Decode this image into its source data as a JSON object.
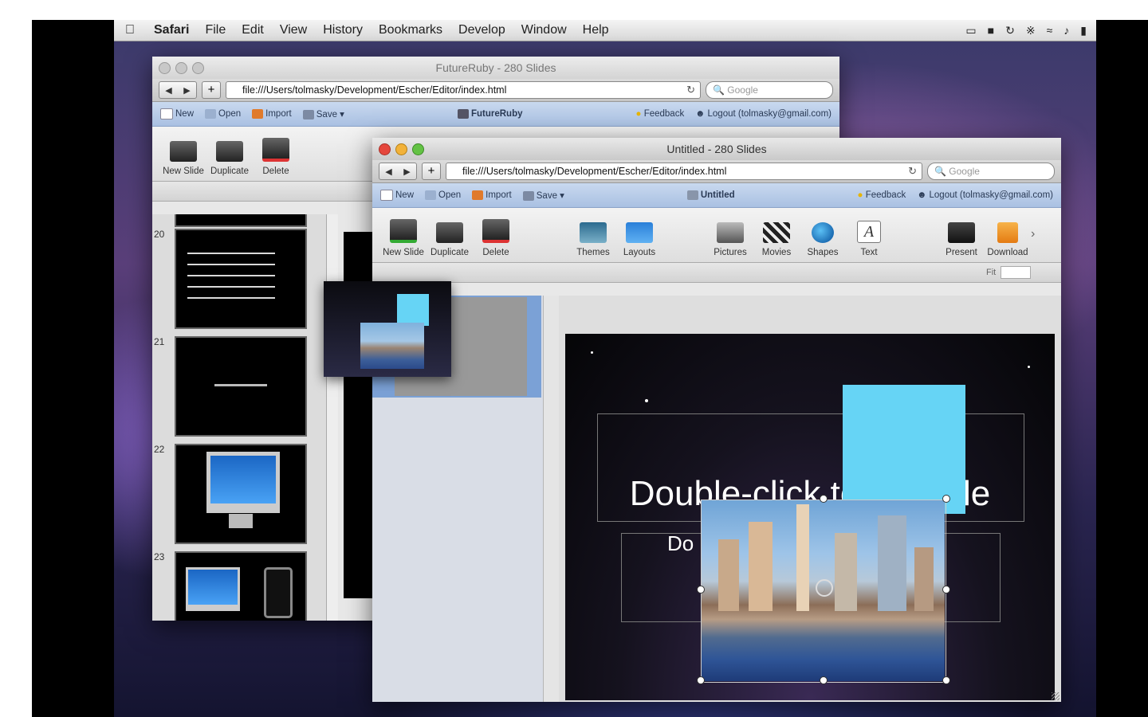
{
  "menubar": {
    "app": "Safari",
    "items": [
      "File",
      "Edit",
      "View",
      "History",
      "Bookmarks",
      "Develop",
      "Window",
      "Help"
    ]
  },
  "back_window": {
    "title": "FutureRuby - 280 Slides",
    "url": "file:///Users/tolmasky/Development/Escher/Editor/index.html",
    "search_placeholder": "Google",
    "toolbar": {
      "new": "New",
      "open": "Open",
      "import": "Import",
      "save": "Save",
      "doc": "FutureRuby",
      "feedback": "Feedback",
      "logout": "Logout (tolmasky@gmail.com)"
    },
    "ribbon": {
      "new_slide": "New Slide",
      "duplicate": "Duplicate",
      "delete": "Delete"
    },
    "slide_numbers": [
      "20",
      "21",
      "22",
      "23"
    ]
  },
  "front_window": {
    "title": "Untitled - 280 Slides",
    "url": "file:///Users/tolmasky/Development/Escher/Editor/index.html",
    "search_placeholder": "Google",
    "toolbar": {
      "new": "New",
      "open": "Open",
      "import": "Import",
      "save": "Save",
      "doc": "Untitled",
      "feedback": "Feedback",
      "logout": "Logout (tolmasky@gmail.com)"
    },
    "ribbon": {
      "new_slide": "New Slide",
      "duplicate": "Duplicate",
      "delete": "Delete",
      "themes": "Themes",
      "layouts": "Layouts",
      "pictures": "Pictures",
      "movies": "Movies",
      "shapes": "Shapes",
      "text": "Text",
      "present": "Present",
      "download": "Download"
    },
    "fit": "Fit"
  },
  "slide": {
    "title_placeholder": "Double-click to edit title",
    "subtitle_fragment": "Do",
    "accent": "#66d4f5"
  },
  "colors": {
    "accent_blue": "#66d4f5",
    "toolbar_blue": "#b8cbe9"
  }
}
